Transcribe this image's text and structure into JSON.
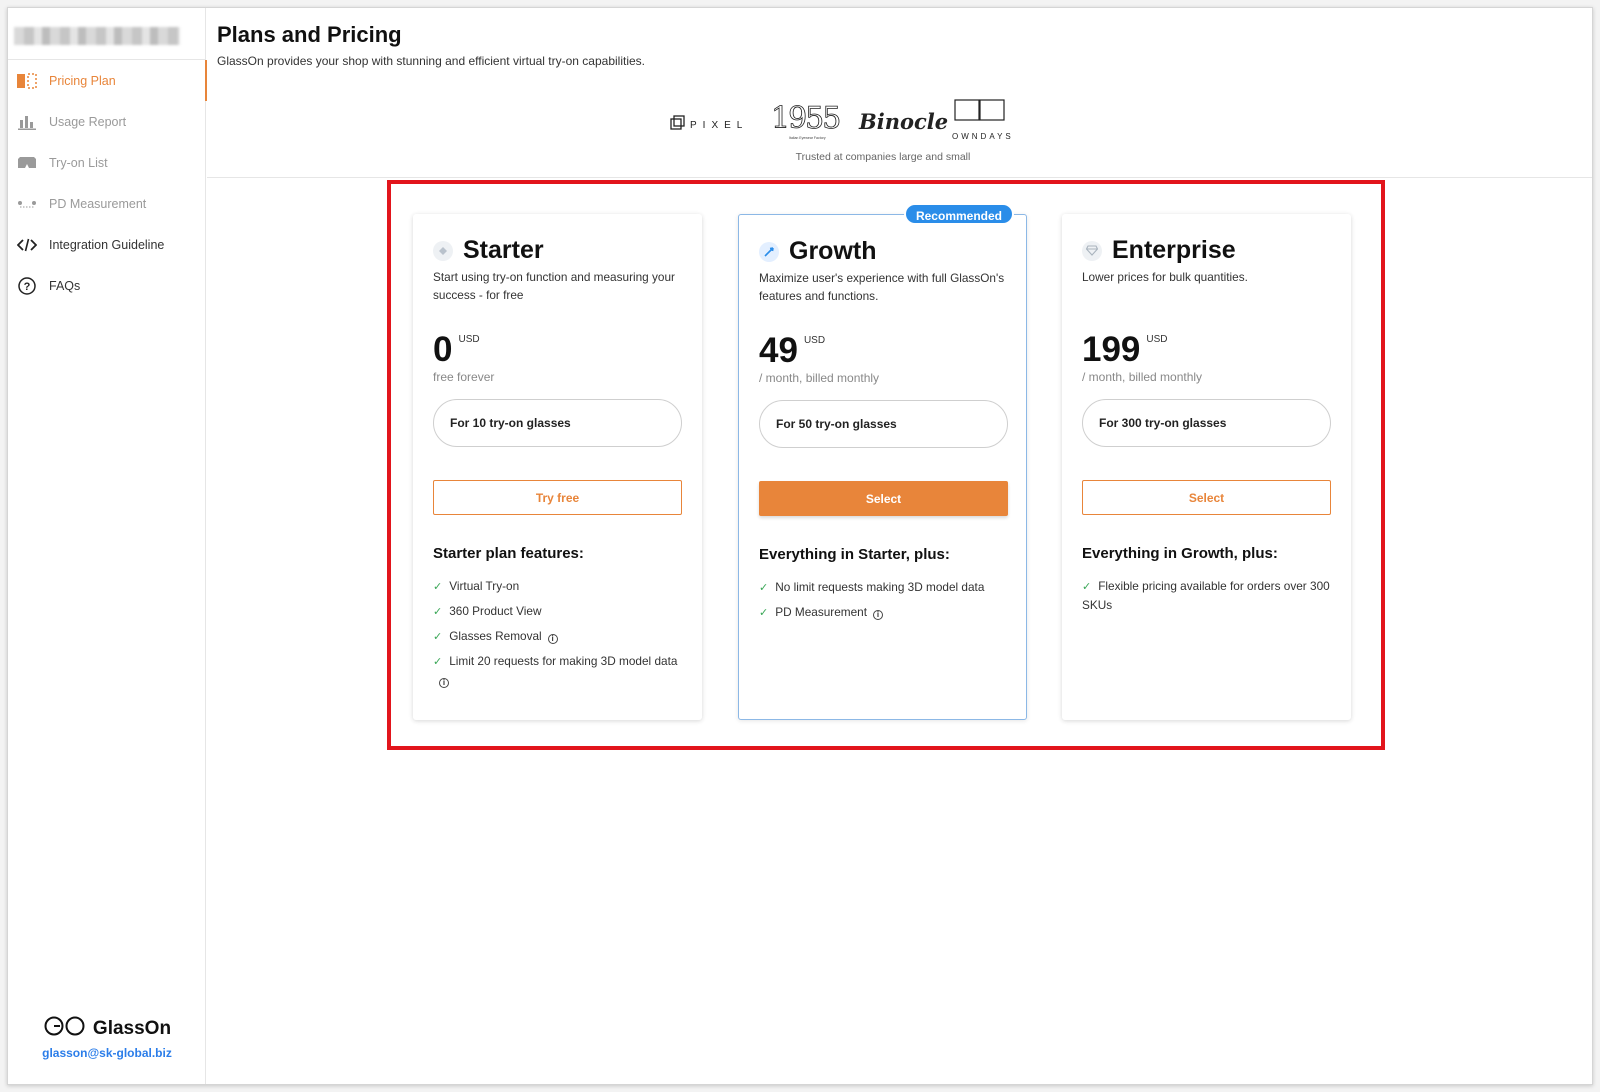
{
  "sidebar": {
    "items": [
      {
        "label": "Pricing Plan",
        "icon": "pricing-plan-icon"
      },
      {
        "label": "Usage Report",
        "icon": "bar-chart-icon"
      },
      {
        "label": "Try-on List",
        "icon": "glasses-icon"
      },
      {
        "label": "PD Measurement",
        "icon": "pd-measurement-icon"
      },
      {
        "label": "Integration Guideline",
        "icon": "code-icon"
      },
      {
        "label": "FAQs",
        "icon": "question-circle-icon"
      }
    ],
    "brand": {
      "name": "GlassOn",
      "email": "glasson@sk-global.biz"
    }
  },
  "header": {
    "title": "Plans and Pricing",
    "subtitle": "GlassOn provides your shop with stunning and efficient virtual try-on capabilities.",
    "logos": [
      {
        "name": "PIXEL"
      },
      {
        "name": "1955",
        "caption": "Italian Eyewear Factory"
      },
      {
        "name": "Binocle"
      },
      {
        "name": "OWNDAYS"
      }
    ],
    "trusted": "Trusted at companies large and small"
  },
  "plans": [
    {
      "name": "Starter",
      "description": "Start using try-on function and measuring your success - for free",
      "price": "0",
      "currency": "USD",
      "price_note": "free forever",
      "glasses": "For 10 try-on glasses",
      "button": "Try free",
      "features_title": "Starter plan features:",
      "features": [
        "Virtual Try-on",
        "360 Product View",
        "Glasses Removal",
        "Limit 20 requests for making 3D model data"
      ]
    },
    {
      "name": "Growth",
      "badge": "Recommended",
      "description": "Maximize user's experience with full GlassOn's features and functions.",
      "price": "49",
      "currency": "USD",
      "price_note": "/ month, billed monthly",
      "glasses": "For 50 try-on glasses",
      "button": "Select",
      "features_title": "Everything in Starter, plus:",
      "features": [
        "No limit requests making 3D model data",
        "PD Measurement"
      ]
    },
    {
      "name": "Enterprise",
      "description": "Lower prices for bulk quantities.",
      "price": "199",
      "currency": "USD",
      "price_note": "/ month, billed monthly",
      "glasses": "For 300 try-on glasses",
      "button": "Select",
      "features_title": "Everything in Growth, plus:",
      "features": [
        "Flexible pricing available for orders over 300 SKUs"
      ]
    }
  ],
  "colors": {
    "accent": "#e8853a",
    "badge": "#2a8de9",
    "highlight": "#e2151c",
    "check": "#3aa757"
  }
}
